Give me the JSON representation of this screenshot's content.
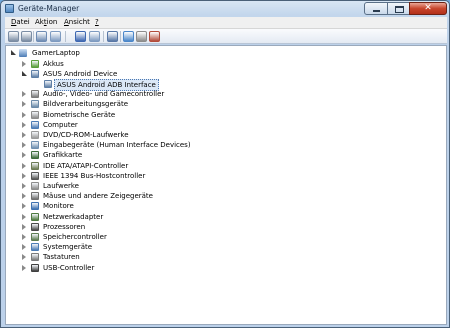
{
  "window": {
    "title": "Geräte-Manager",
    "controls": {
      "minimize": "",
      "maximize": "",
      "close": "✕"
    }
  },
  "menu": [
    {
      "label": "Datei"
    },
    {
      "label": "Aktion"
    },
    {
      "label": "Ansicht"
    },
    {
      "label": "?"
    }
  ],
  "toolbar": [
    {
      "icon": "back-arrow-icon",
      "color": "#7a8ca3"
    },
    {
      "icon": "forward-arrow-icon",
      "color": "#7a8ca3"
    },
    {
      "icon": "show-hide-console-tree-icon",
      "color": "#6d8bb3"
    },
    {
      "icon": "properties-icon",
      "color": "#7d9ac0"
    },
    {
      "icon": "help-icon",
      "color": "#3d67b1"
    },
    {
      "icon": "action-pane-icon",
      "color": "#7d9ac0"
    },
    {
      "icon": "scan-hardware-icon",
      "color": "#5877a6"
    },
    {
      "icon": "update-driver-icon",
      "color": "#4a86c9"
    },
    {
      "icon": "disable-device-icon",
      "color": "#8c8c8c"
    },
    {
      "icon": "uninstall-device-icon",
      "color": "#b24b3a"
    }
  ],
  "tree": {
    "root": "GamerLaptop",
    "items": [
      {
        "label": "Akkus",
        "level": 1,
        "state": "collapsed",
        "icon": "battery-icon",
        "color": "#5a9e3b"
      },
      {
        "label": "ASUS Android Device",
        "level": 1,
        "state": "expanded",
        "icon": "android-device-icon",
        "color": "#5f7fa6"
      },
      {
        "label": "ASUS Android ADB Interface",
        "level": 2,
        "state": "leaf",
        "icon": "adb-interface-icon",
        "color": "#5f7fa6",
        "selected": true
      },
      {
        "label": "Audio-, Video- und Gamecontroller",
        "level": 1,
        "state": "collapsed",
        "icon": "speaker-icon",
        "color": "#7b7b7b"
      },
      {
        "label": "Bildverarbeitungsgeräte",
        "level": 1,
        "state": "collapsed",
        "icon": "camera-icon",
        "color": "#6b8aa8"
      },
      {
        "label": "Biometrische Geräte",
        "level": 1,
        "state": "collapsed",
        "icon": "fingerprint-icon",
        "color": "#8b8b8b"
      },
      {
        "label": "Computer",
        "level": 1,
        "state": "collapsed",
        "icon": "computer-icon",
        "color": "#4b7bb5"
      },
      {
        "label": "DVD/CD-ROM-Laufwerke",
        "level": 1,
        "state": "collapsed",
        "icon": "optical-drive-icon",
        "color": "#9a9a9a"
      },
      {
        "label": "Eingabegeräte (Human Interface Devices)",
        "level": 1,
        "state": "collapsed",
        "icon": "hid-icon",
        "color": "#6f8fb0"
      },
      {
        "label": "Grafikkarte",
        "level": 1,
        "state": "collapsed",
        "icon": "display-adapter-icon",
        "color": "#3c6b3a"
      },
      {
        "label": "IDE ATA/ATAPI-Controller",
        "level": 1,
        "state": "collapsed",
        "icon": "ide-controller-icon",
        "color": "#6a7a52"
      },
      {
        "label": "IEEE 1394 Bus-Hostcontroller",
        "level": 1,
        "state": "collapsed",
        "icon": "firewire-icon",
        "color": "#555555"
      },
      {
        "label": "Laufwerke",
        "level": 1,
        "state": "collapsed",
        "icon": "disk-drive-icon",
        "color": "#8c8c8c"
      },
      {
        "label": "Mäuse und andere Zeigegeräte",
        "level": 1,
        "state": "collapsed",
        "icon": "mouse-icon",
        "color": "#6f6f6f"
      },
      {
        "label": "Monitore",
        "level": 1,
        "state": "collapsed",
        "icon": "monitor-icon",
        "color": "#3d70b0"
      },
      {
        "label": "Netzwerkadapter",
        "level": 1,
        "state": "collapsed",
        "icon": "network-adapter-icon",
        "color": "#4d7a3f"
      },
      {
        "label": "Prozessoren",
        "level": 1,
        "state": "collapsed",
        "icon": "processor-icon",
        "color": "#4a4a4a"
      },
      {
        "label": "Speichercontroller",
        "level": 1,
        "state": "collapsed",
        "icon": "storage-controller-icon",
        "color": "#5d7d52"
      },
      {
        "label": "Systemgeräte",
        "level": 1,
        "state": "collapsed",
        "icon": "system-device-icon",
        "color": "#4b7bb5"
      },
      {
        "label": "Tastaturen",
        "level": 1,
        "state": "collapsed",
        "icon": "keyboard-icon",
        "color": "#7a7a7a"
      },
      {
        "label": "USB-Controller",
        "level": 1,
        "state": "collapsed",
        "icon": "usb-icon",
        "color": "#3f3f3f"
      }
    ]
  },
  "colors": {
    "selection_bg": "#dbe8f7",
    "selection_border": "#4d79b2",
    "root_icon": "#4b7bb5"
  }
}
